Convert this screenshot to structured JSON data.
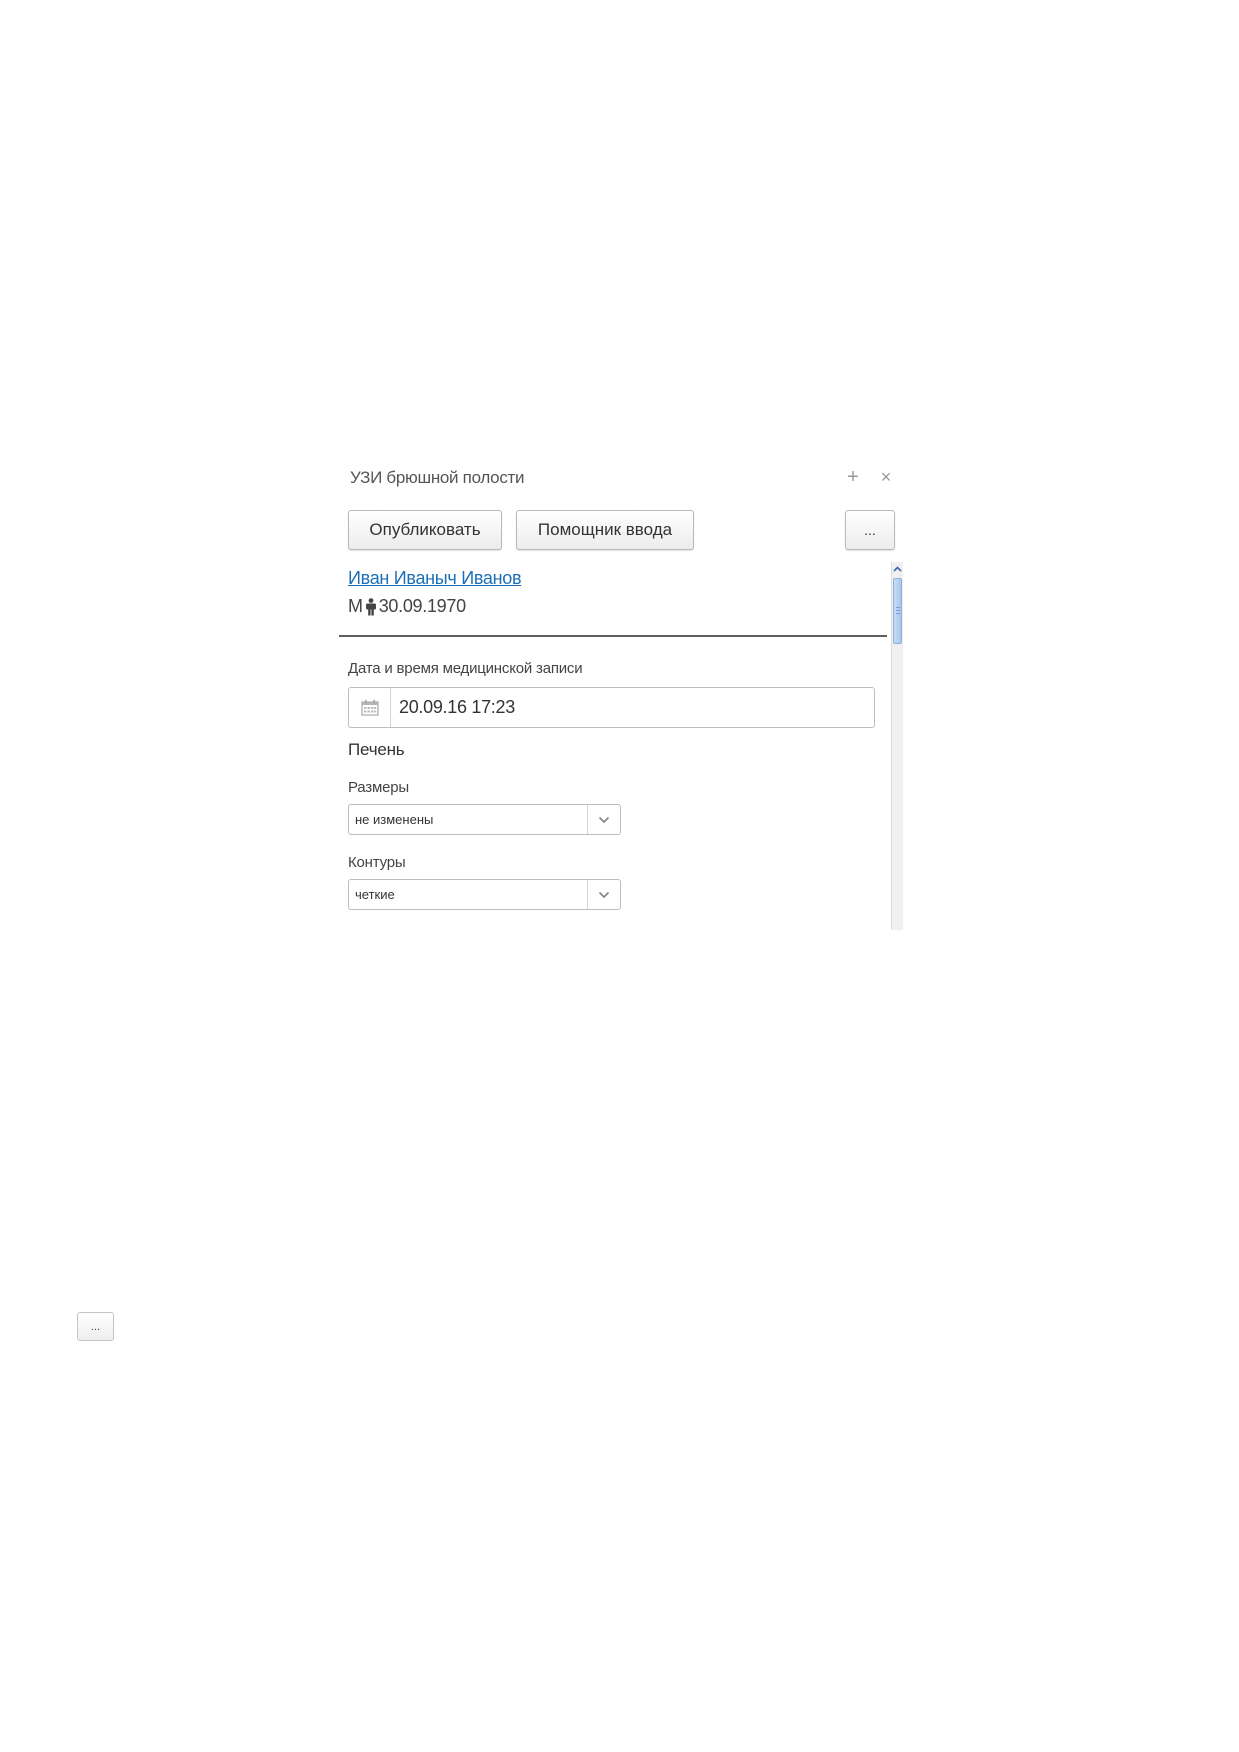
{
  "window": {
    "title": "УЗИ брюшной полости",
    "plus_symbol": "+",
    "close_symbol": "×"
  },
  "toolbar": {
    "publish_label": "Опубликовать",
    "helper_label": "Помощник ввода",
    "more_label": "..."
  },
  "patient": {
    "name": "Иван Иваныч Иванов",
    "sex": "М",
    "birth_date": "30.09.1970"
  },
  "record_datetime": {
    "label": "Дата и время медицинской записи",
    "value": "20.09.16 17:23"
  },
  "section": {
    "title": "Печень"
  },
  "fields": {
    "sizes": {
      "label": "Размеры",
      "value": "не изменены"
    },
    "contours": {
      "label": "Контуры",
      "value": "четкие"
    }
  },
  "bottom": {
    "more_label": "..."
  },
  "colors": {
    "link": "#1b6fb8",
    "scroll_thumb": "#a9c6ee"
  }
}
